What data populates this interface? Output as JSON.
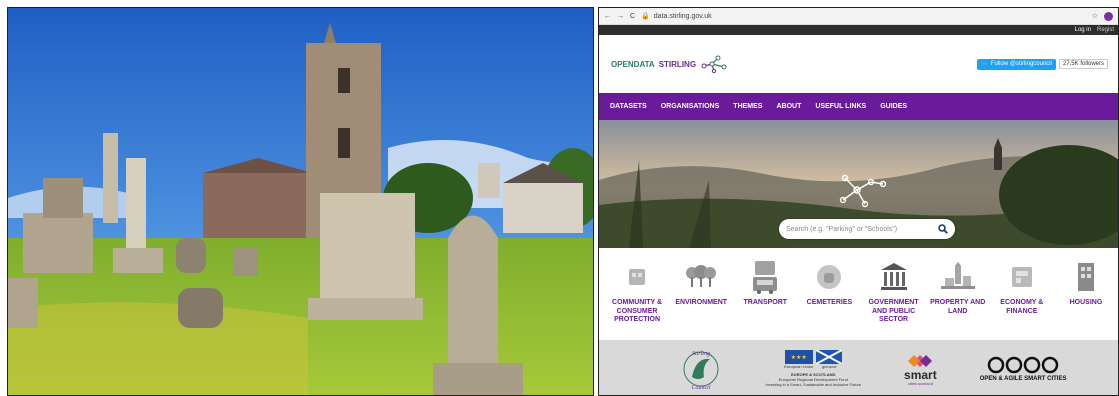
{
  "browser": {
    "url": "data.stirling.gov.uk",
    "login": "Log in",
    "register": "Regist"
  },
  "header": {
    "logo_left": "OPENDATA",
    "logo_right": "STIRLING",
    "twitter_label": "Follow @stirlingcouncil",
    "followers": "27.5K followers"
  },
  "nav": {
    "items": [
      "DATASETS",
      "ORGANISATIONS",
      "THEMES",
      "ABOUT",
      "USEFUL LINKS",
      "GUIDES"
    ]
  },
  "search": {
    "placeholder": "Search (e.g. \"Parking\" or \"Schools\")"
  },
  "themes": [
    {
      "label": "COMMUNITY & CONSUMER PROTECTION",
      "icon": "community-icon"
    },
    {
      "label": "ENVIRONMENT",
      "icon": "trees-icon"
    },
    {
      "label": "TRANSPORT",
      "icon": "bus-icon"
    },
    {
      "label": "CEMETERIES",
      "icon": "cemetery-icon"
    },
    {
      "label": "GOVERNMENT AND PUBLIC SECTOR",
      "icon": "government-icon"
    },
    {
      "label": "PROPERTY AND LAND",
      "icon": "property-icon"
    },
    {
      "label": "ECONOMY & FINANCE",
      "icon": "finance-icon"
    },
    {
      "label": "HOUSING",
      "icon": "housing-icon"
    }
  ],
  "partners": {
    "stirling_council": "Stirling Council",
    "eu_title": "EUROPE & SCOTLAND",
    "eu_line1": "European Regional Development Fund",
    "eu_line2": "Investing in a Smart, Sustainable and Inclusive Future",
    "eu_fund": "European Union",
    "gov_scot": "gov.scot",
    "smart": "smart",
    "smart_sub": "cities scotland",
    "oasc": "OPEN & AGILE SMART CITIES"
  },
  "colors": {
    "nav": "#6a1b9a",
    "accent_green": "#2f7d5b",
    "theme_label": "#6a1b9a"
  }
}
